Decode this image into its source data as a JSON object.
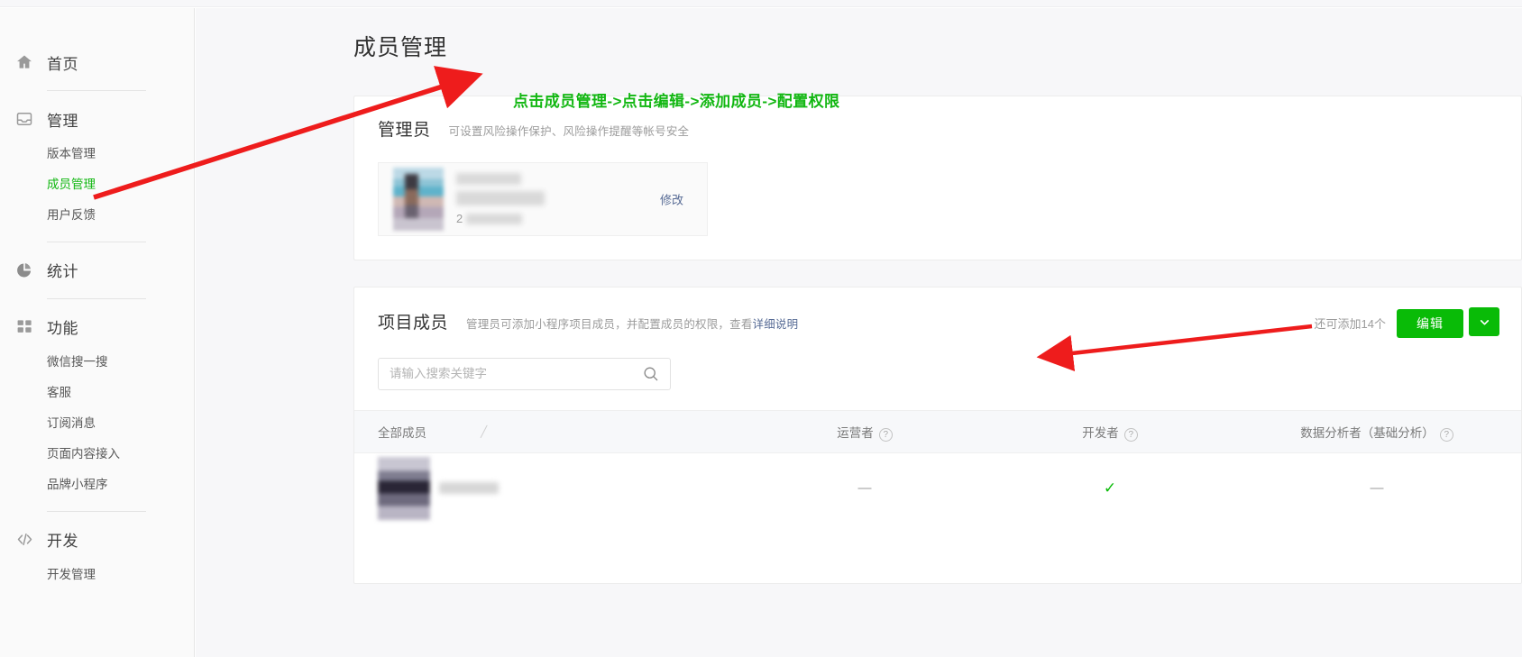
{
  "sidebar": {
    "groups": [
      {
        "icon": "home-icon",
        "label": "首页",
        "items": []
      },
      {
        "icon": "inbox-icon",
        "label": "管理",
        "items": [
          {
            "label": "版本管理",
            "active": false
          },
          {
            "label": "成员管理",
            "active": true
          },
          {
            "label": "用户反馈",
            "active": false
          }
        ]
      },
      {
        "icon": "pie-chart-icon",
        "label": "统计",
        "items": []
      },
      {
        "icon": "grid-icon",
        "label": "功能",
        "items": [
          {
            "label": "微信搜一搜",
            "active": false
          },
          {
            "label": "客服",
            "active": false
          },
          {
            "label": "订阅消息",
            "active": false
          },
          {
            "label": "页面内容接入",
            "active": false
          },
          {
            "label": "品牌小程序",
            "active": false
          }
        ]
      },
      {
        "icon": "code-icon",
        "label": "开发",
        "items": [
          {
            "label": "开发管理",
            "active": false
          }
        ]
      }
    ]
  },
  "page": {
    "title": "成员管理",
    "annotation": "点击成员管理->点击编辑->添加成员->配置权限",
    "annotation_color": "#12b712",
    "arrow_color": "#ee1c1c"
  },
  "admin_card": {
    "title": "管理员",
    "subtitle": "可设置风险操作保护、风险操作提醒等帐号安全",
    "modify_label": "修改",
    "member_name_masked": "",
    "member_id_masked": "2"
  },
  "members_card": {
    "title": "项目成员",
    "subtitle_prefix": "管理员可添加小程序项目成员，并配置成员的权限，查看",
    "subtitle_link": "详细说明",
    "remaining": "还可添加14个",
    "edit_label": "编辑",
    "caret_icon": "chevron-down-icon",
    "search_placeholder": "请输入搜索关键字",
    "search_value": "",
    "table": {
      "headers": [
        {
          "label": "全部成员",
          "help": false
        },
        {
          "label": "运营者",
          "help": true
        },
        {
          "label": "开发者",
          "help": true
        },
        {
          "label": "数据分析者（基础分析）",
          "help": true
        }
      ],
      "rows": [
        {
          "name_masked": "",
          "operator": "—",
          "developer": "✓",
          "analyst": "—"
        }
      ]
    }
  },
  "colors": {
    "brand_green": "#09bb07",
    "annotation_green": "#12b712",
    "link_blue": "#576b95",
    "arrow_red": "#ee1c1c"
  }
}
